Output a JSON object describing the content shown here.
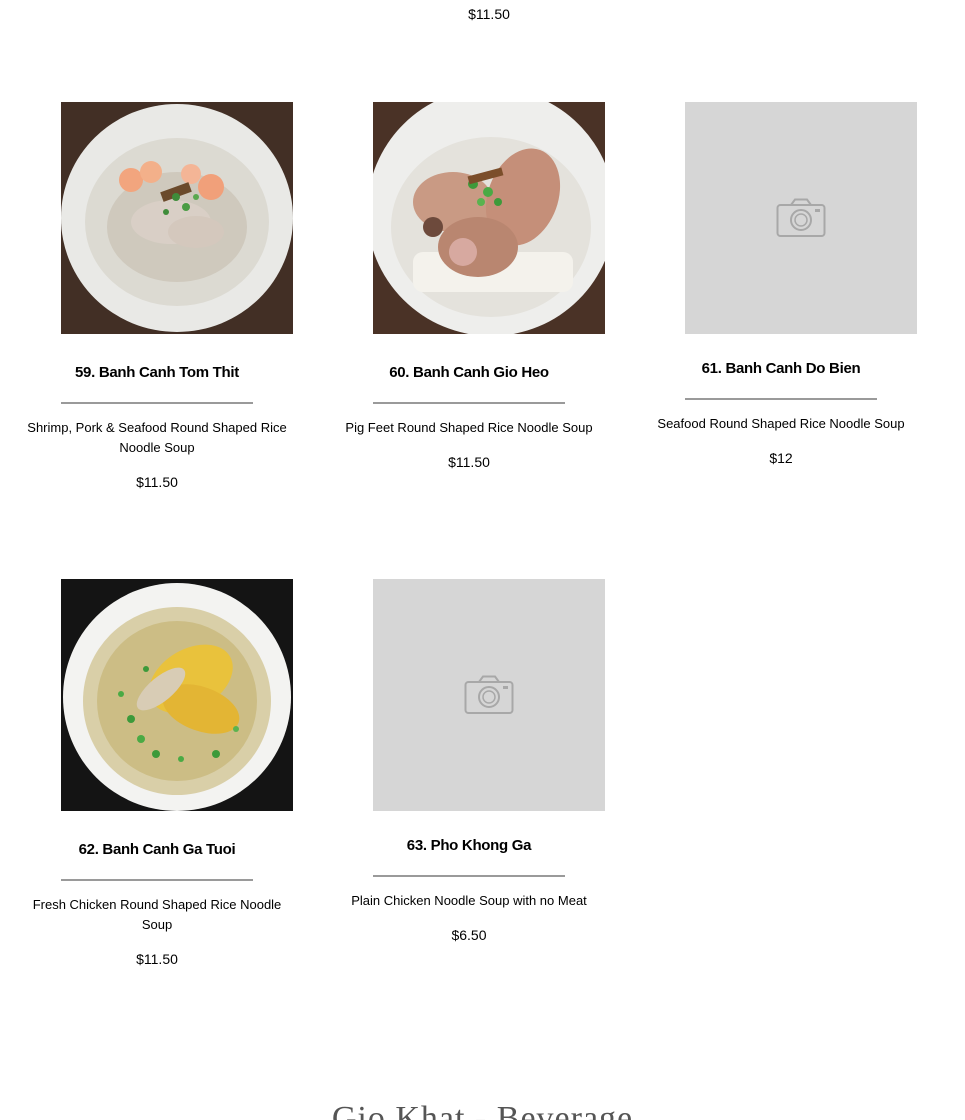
{
  "top_item": {
    "price": "$11.50"
  },
  "items": [
    {
      "title": "59. Banh Canh Tom Thit",
      "description": "Shrimp, Pork & Seafood Round Shaped Rice Noodle Soup",
      "price": "$11.50",
      "image": "noodle-soup-shrimp-pork-photo"
    },
    {
      "title": "60. Banh Canh Gio Heo",
      "description": "Pig Feet Round Shaped Rice Noodle Soup",
      "price": "$11.50",
      "image": "noodle-soup-pig-feet-photo"
    },
    {
      "title": "61. Banh Canh Do Bien",
      "description": "Seafood Round Shaped Rice Noodle Soup",
      "price": "$12",
      "image": "camera-placeholder-icon"
    },
    {
      "title": "62. Banh Canh Ga Tuoi",
      "description": "Fresh Chicken Round Shaped Rice Noodle Soup",
      "price": "$11.50",
      "image": "noodle-soup-chicken-photo"
    },
    {
      "title": "63. Pho Khong Ga",
      "description": "Plain Chicken Noodle Soup with no Meat",
      "price": "$6.50",
      "image": "camera-placeholder-icon"
    }
  ],
  "next_section": {
    "title": "Gio Khat - Beverage"
  },
  "colors": {
    "placeholder_bg": "#d6d6d6",
    "divider": "#9a9a9a",
    "bowl_white": "#f2f2f0",
    "dark_table": "#3a2a22"
  }
}
